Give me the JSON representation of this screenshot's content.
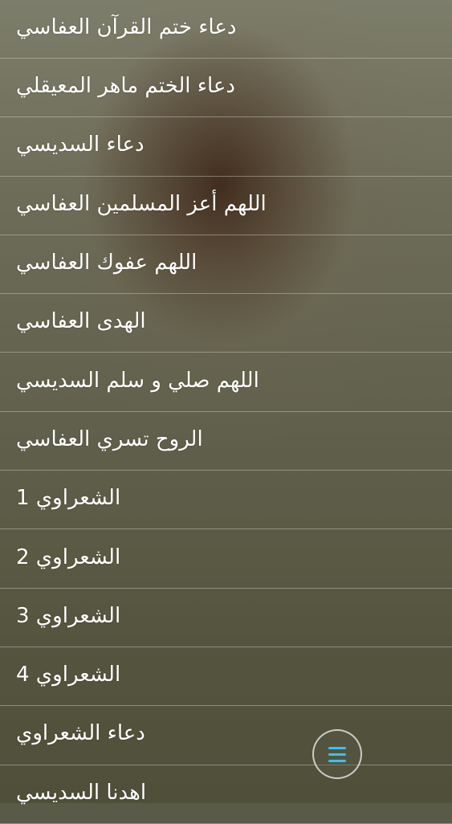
{
  "list": {
    "items": [
      {
        "label": "دعاء ختم القرآن العفاسي"
      },
      {
        "label": "دعاء الختم ماهر المعيقلي"
      },
      {
        "label": "دعاء السديسي"
      },
      {
        "label": "اللهم أعز المسلمين العفاسي"
      },
      {
        "label": "اللهم عفوك العفاسي"
      },
      {
        "label": "الهدى العفاسي"
      },
      {
        "label": "اللهم صلي و سلم السديسي"
      },
      {
        "label": "الروح تسري العفاسي"
      },
      {
        "label": "الشعراوي 1"
      },
      {
        "label": "الشعراوي 2"
      },
      {
        "label": "الشعراوي 3"
      },
      {
        "label": "الشعراوي 4"
      },
      {
        "label": "دعاء الشعراوي"
      },
      {
        "label": "اهدنا السديسي"
      }
    ]
  },
  "menu": {
    "icon": "hamburger-menu-icon",
    "accent_color": "#37c3ea"
  }
}
